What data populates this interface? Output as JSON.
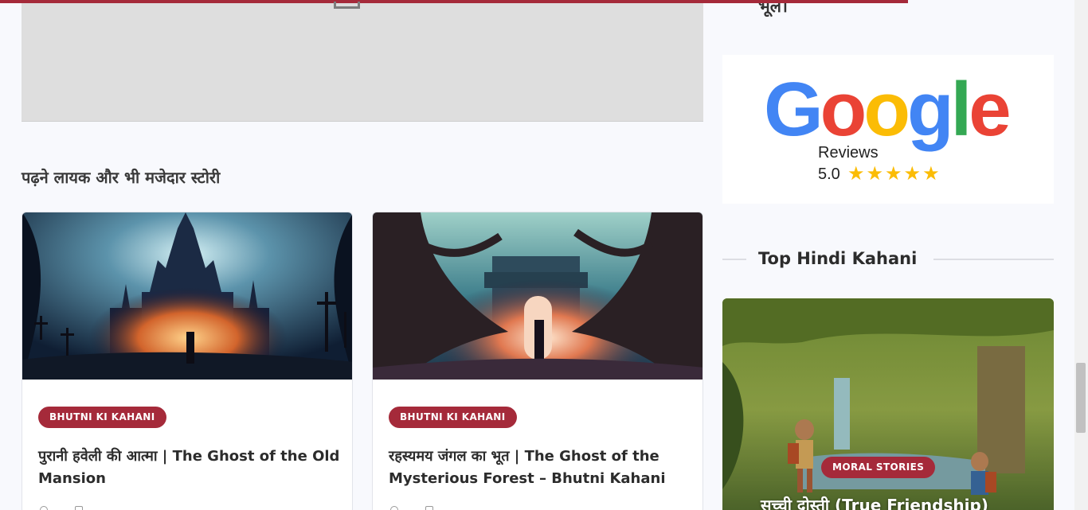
{
  "sidebar": {
    "fragment_text": "भूल।",
    "google_reviews": {
      "logo_text": [
        "G",
        "o",
        "o",
        "g",
        "l",
        "e"
      ],
      "reviews_label": "Reviews",
      "rating": "5.0",
      "stars": "★★★★★"
    },
    "top_widget": {
      "title": "Top Hindi Kahani",
      "story": {
        "category": "MORAL STORIES",
        "title": "सच्ची दोस्ती (True Friendship)"
      }
    }
  },
  "related": {
    "section_title": "पढ़ने लायक और भी मजेदार स्टोरी",
    "cards": [
      {
        "category": "BHUTNI KI KAHANI",
        "title": "पुरानी हवेली की आत्मा | The Ghost of the Old Mansion"
      },
      {
        "category": "BHUTNI KI KAHANI",
        "title": "रहस्यमय जंगल का भूत | The Ghost of the Mysterious Forest – Bhutni Kahani"
      }
    ]
  },
  "colors": {
    "accent": "#a52a3a",
    "background": "#f8f9fd"
  }
}
